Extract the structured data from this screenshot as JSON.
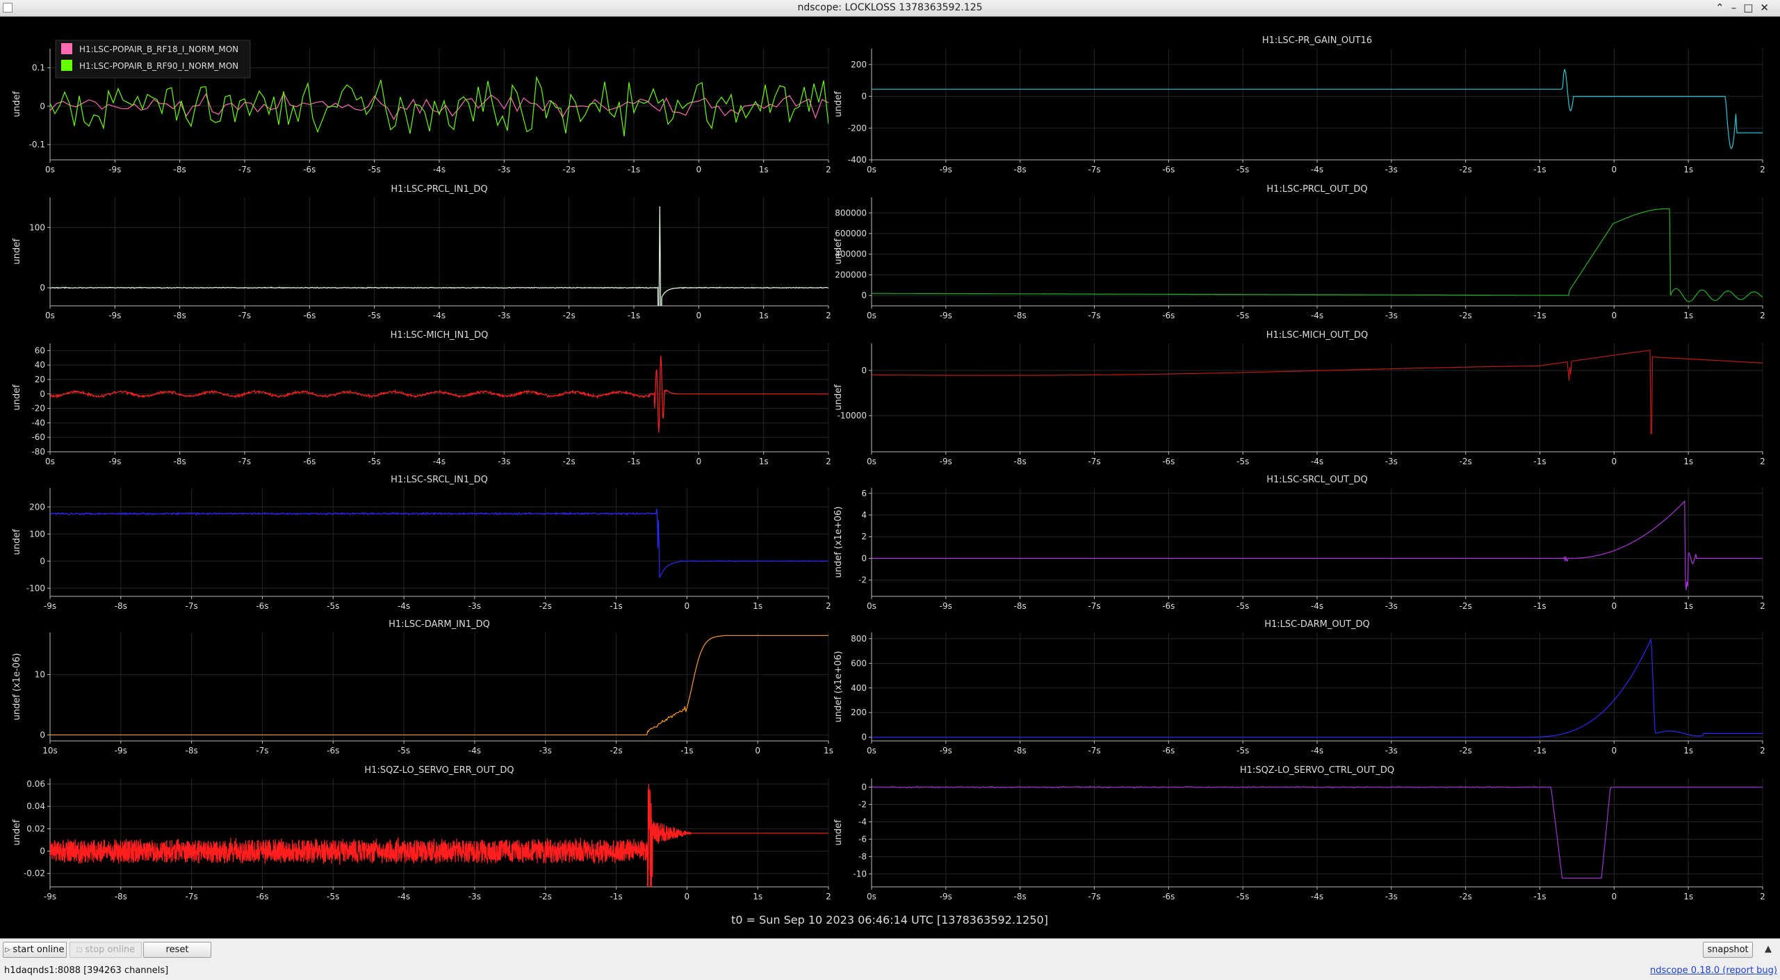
{
  "window": {
    "title": "ndscope: LOCKLOSS 1378363592.125"
  },
  "t0_label": "t0 = Sun Sep 10 2023 06:46:14 UTC [1378363592.1250]",
  "colors": {
    "pink": "#ff69b4",
    "green": "#66ff00",
    "cyan": "#22c8d8",
    "white": "#e8ffe8",
    "darkgreen": "#1fb51f",
    "red": "#ff1e1e",
    "darkred": "#c01818",
    "blue": "#2828ff",
    "purple": "#b02fe0",
    "orange": "#ff9a1e",
    "violet": "#a030d8"
  },
  "plots": [
    {
      "title": "",
      "ylabel": "undef",
      "ylim": [
        -0.14,
        0.15
      ],
      "yticks": [
        "0.1",
        "0",
        "-0.1"
      ],
      "ytick_values": [
        0.1,
        0,
        -0.1
      ],
      "xticks": [
        "0s",
        "-9s",
        "-8s",
        "-7s",
        "-6s",
        "-5s",
        "-4s",
        "-3s",
        "-2s",
        "-1s",
        "0",
        "1s",
        "2"
      ],
      "legend": [
        {
          "label": "H1:LSC-POPAIR_B_RF18_I_NORM_MON",
          "color": "#ff69b4"
        },
        {
          "label": "H1:LSC-POPAIR_B_RF90_I_NORM_MON",
          "color": "#66ff00"
        }
      ]
    },
    {
      "title": "H1:LSC-PR_GAIN_OUT16",
      "ylabel": "undef",
      "ylim": [
        -400,
        300
      ],
      "yticks": [
        "200",
        "0",
        "-200",
        "-400"
      ],
      "ytick_values": [
        200,
        0,
        -200,
        -400
      ],
      "xticks": [
        "0s",
        "-9s",
        "-8s",
        "-7s",
        "-6s",
        "-5s",
        "-4s",
        "-3s",
        "-2s",
        "-1s",
        "0",
        "1s",
        "2"
      ],
      "legend": []
    },
    {
      "title": "H1:LSC-PRCL_IN1_DQ",
      "ylabel": "undef",
      "ylim": [
        -30,
        150
      ],
      "yticks": [
        "100",
        "0"
      ],
      "ytick_values": [
        100,
        0
      ],
      "xticks": [
        "0s",
        "-9s",
        "-8s",
        "-7s",
        "-6s",
        "-5s",
        "-4s",
        "-3s",
        "-2s",
        "-1s",
        "0",
        "1s",
        "2"
      ],
      "legend": []
    },
    {
      "title": "H1:LSC-PRCL_OUT_DQ",
      "ylabel": "undef",
      "ylim": [
        -100000,
        950000
      ],
      "yticks": [
        "800000",
        "600000",
        "400000",
        "200000",
        "0"
      ],
      "ytick_values": [
        800000,
        600000,
        400000,
        200000,
        0
      ],
      "xticks": [
        "0s",
        "-9s",
        "-8s",
        "-7s",
        "-6s",
        "-5s",
        "-4s",
        "-3s",
        "-2s",
        "-1s",
        "0",
        "1s",
        "2"
      ],
      "legend": []
    },
    {
      "title": "H1:LSC-MICH_IN1_DQ",
      "ylabel": "undef",
      "ylim": [
        -80,
        70
      ],
      "yticks": [
        "60",
        "40",
        "20",
        "0",
        "-20",
        "-40",
        "-60",
        "-80"
      ],
      "ytick_values": [
        60,
        40,
        20,
        0,
        -20,
        -40,
        -60,
        -80
      ],
      "xticks": [
        "0s",
        "-9s",
        "-8s",
        "-7s",
        "-6s",
        "-5s",
        "-4s",
        "-3s",
        "-2s",
        "-1s",
        "0",
        "1s",
        "2"
      ],
      "legend": []
    },
    {
      "title": "H1:LSC-MICH_OUT_DQ",
      "ylabel": "undef",
      "ylim": [
        -18000,
        6000
      ],
      "yticks": [
        "0",
        "-10000"
      ],
      "ytick_values": [
        0,
        -10000
      ],
      "xticks": [
        "0s",
        "-9s",
        "-8s",
        "-7s",
        "-6s",
        "-5s",
        "-4s",
        "-3s",
        "-2s",
        "-1s",
        "0",
        "1s",
        "2"
      ],
      "legend": []
    },
    {
      "title": "H1:LSC-SRCL_IN1_DQ",
      "ylabel": "undef",
      "ylim": [
        -130,
        270
      ],
      "yticks": [
        "200",
        "100",
        "0",
        "-100"
      ],
      "ytick_values": [
        200,
        100,
        0,
        -100
      ],
      "xticks": [
        "-9s",
        "-8s",
        "-7s",
        "-6s",
        "-5s",
        "-4s",
        "-3s",
        "-2s",
        "-1s",
        "0",
        "1s",
        "2"
      ],
      "legend": []
    },
    {
      "title": "H1:LSC-SRCL_OUT_DQ",
      "ylabel": "undef (x1e+06)",
      "ylim": [
        -3.5,
        6.5
      ],
      "yticks": [
        "6",
        "4",
        "2",
        "0",
        "-2"
      ],
      "ytick_values": [
        6,
        4,
        2,
        0,
        -2
      ],
      "xticks": [
        "0s",
        "-9s",
        "-8s",
        "-7s",
        "-6s",
        "-5s",
        "-4s",
        "-3s",
        "-2s",
        "-1s",
        "0",
        "1s",
        "2"
      ],
      "legend": []
    },
    {
      "title": "H1:LSC-DARM_IN1_DQ",
      "ylabel": "undef (x1e-06)",
      "ylim": [
        -1,
        17
      ],
      "yticks": [
        "10",
        "0"
      ],
      "ytick_values": [
        10,
        0
      ],
      "xticks": [
        "10s",
        "-9s",
        "-8s",
        "-7s",
        "-6s",
        "-5s",
        "-4s",
        "-3s",
        "-2s",
        "-1s",
        "0",
        "1s"
      ],
      "legend": []
    },
    {
      "title": "H1:LSC-DARM_OUT_DQ",
      "ylabel": "undef (x1e+06)",
      "ylim": [
        -30,
        850
      ],
      "yticks": [
        "800",
        "600",
        "400",
        "200",
        "0"
      ],
      "ytick_values": [
        800,
        600,
        400,
        200,
        0
      ],
      "xticks": [
        "0s",
        "-9s",
        "-8s",
        "-7s",
        "-6s",
        "-5s",
        "-4s",
        "-3s",
        "-2s",
        "-1s",
        "0",
        "1s",
        "2"
      ],
      "legend": []
    },
    {
      "title": "H1:SQZ-LO_SERVO_ERR_OUT_DQ",
      "ylabel": "undef",
      "ylim": [
        -0.032,
        0.065
      ],
      "yticks": [
        "0.06",
        "0.04",
        "0.02",
        "0",
        "-0.02"
      ],
      "ytick_values": [
        0.06,
        0.04,
        0.02,
        0,
        -0.02
      ],
      "xticks": [
        "-9s",
        "-8s",
        "-7s",
        "-6s",
        "-5s",
        "-4s",
        "-3s",
        "-2s",
        "-1s",
        "0",
        "1s",
        "2"
      ],
      "legend": []
    },
    {
      "title": "H1:SQZ-LO_SERVO_CTRL_OUT_DQ",
      "ylabel": "undef",
      "ylim": [
        -11.5,
        1
      ],
      "yticks": [
        "0",
        "-2",
        "-4",
        "-6",
        "-8",
        "-10"
      ],
      "ytick_values": [
        0,
        -2,
        -4,
        -6,
        -8,
        -10
      ],
      "xticks": [
        "0s",
        "-9s",
        "-8s",
        "-7s",
        "-6s",
        "-5s",
        "-4s",
        "-3s",
        "-2s",
        "-1s",
        "0",
        "1s",
        "2"
      ],
      "legend": []
    }
  ],
  "toolbar": {
    "start_online": "start online",
    "stop_online": "stop online",
    "reset": "reset",
    "snapshot": "snapshot"
  },
  "status": {
    "server": "h1daqnds1:8088  [394263 channels]",
    "version": "ndscope 0.18.0 (report bug)"
  }
}
